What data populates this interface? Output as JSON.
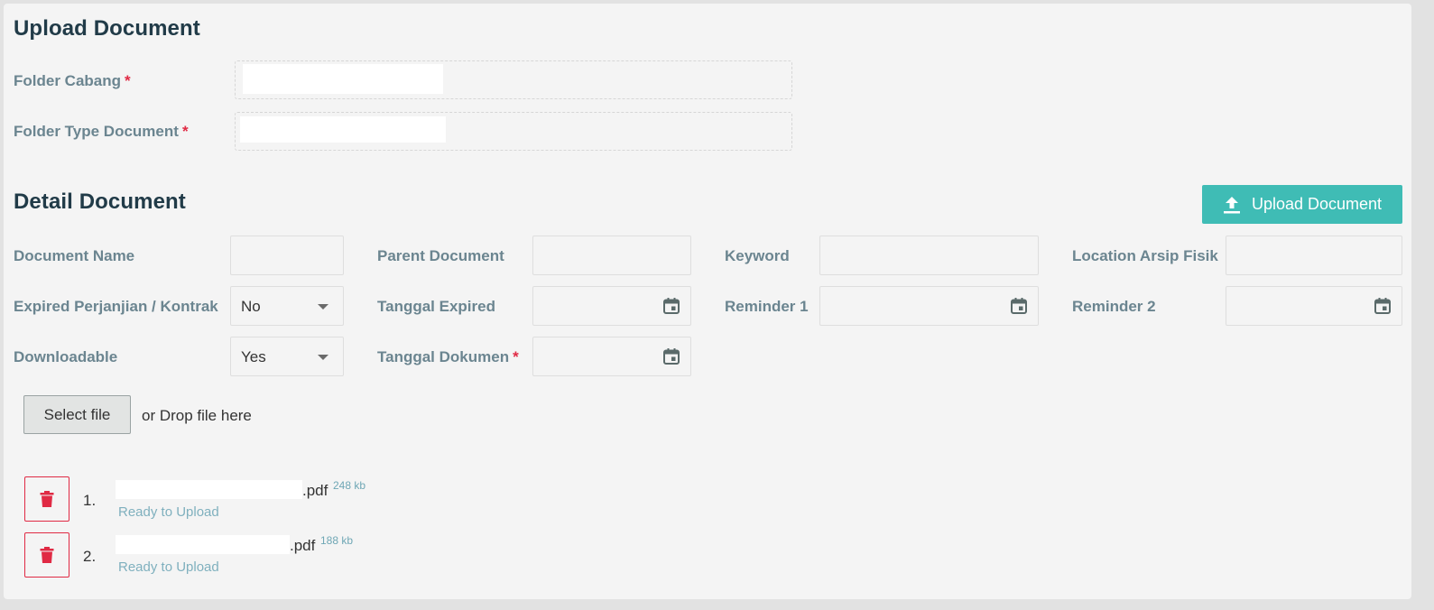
{
  "upload_section": {
    "title": "Upload Document",
    "folder_cabang_label": "Folder Cabang",
    "folder_type_label": "Folder Type Document",
    "required_mark": "*"
  },
  "detail_section": {
    "title": "Detail Document",
    "upload_button_label": "Upload Document",
    "fields": {
      "document_name": "Document Name",
      "parent_document": "Parent Document",
      "keyword": "Keyword",
      "location_arsip_fisik": "Location Arsip Fisik",
      "expired_perjanjian": "Expired Perjanjian / Kontrak",
      "tanggal_expired": "Tanggal Expired",
      "reminder_1": "Reminder 1",
      "reminder_2": "Reminder 2",
      "downloadable": "Downloadable",
      "tanggal_dokumen": "Tanggal Dokumen"
    },
    "expired_value": "No",
    "downloadable_value": "Yes"
  },
  "file_picker": {
    "select_label": "Select file",
    "drop_text": "or Drop file here"
  },
  "files": [
    {
      "index": "1.",
      "ext": ".pdf",
      "size": "248 kb",
      "status": "Ready to Upload"
    },
    {
      "index": "2.",
      "ext": ".pdf",
      "size": "188 kb",
      "status": "Ready to Upload"
    }
  ],
  "icons": {
    "upload": "upload-icon",
    "calendar": "calendar-icon",
    "trash": "trash-icon",
    "caret": "chevron-down-icon"
  },
  "colors": {
    "accent": "#3fbcb5",
    "danger": "#e02a44",
    "heading": "#213b48",
    "label": "#6b8590"
  }
}
